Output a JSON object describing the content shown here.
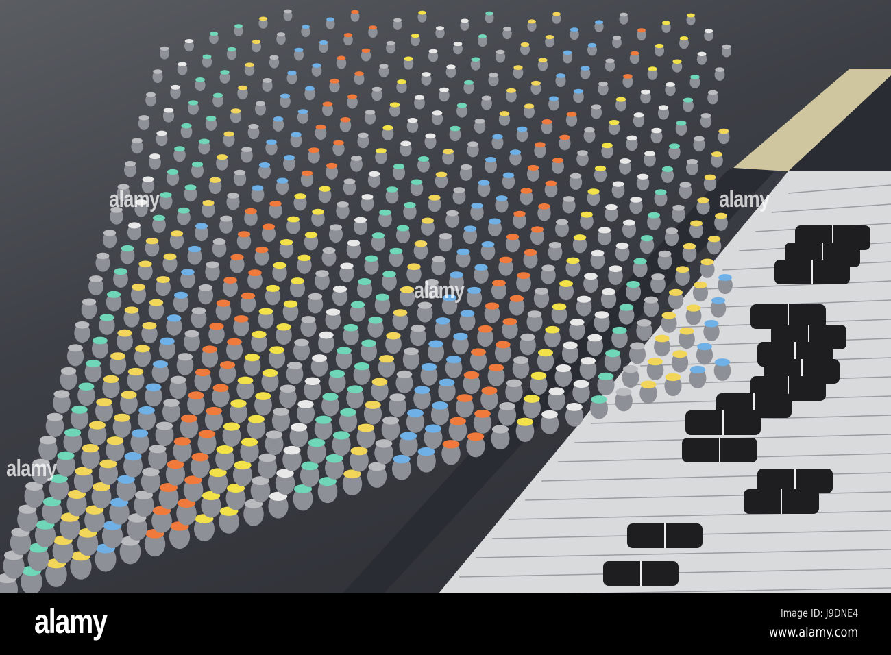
{
  "photo": {
    "subject": "mixing-console",
    "knob_cap_colors": [
      "#e8e8e8",
      "#6fd6b8",
      "#f2d65a",
      "#6fb0e6",
      "#f07a3c",
      "#f3e14a"
    ],
    "knob_body_color": "#8d9096",
    "fader_cap_color": "#1e1e20",
    "panel_color": "#d8dadc"
  },
  "watermark": {
    "text": "alamy"
  },
  "footer": {
    "logo": "alamy",
    "image_id": "Image ID: J9DNE4",
    "url": "www.alamy.com"
  }
}
